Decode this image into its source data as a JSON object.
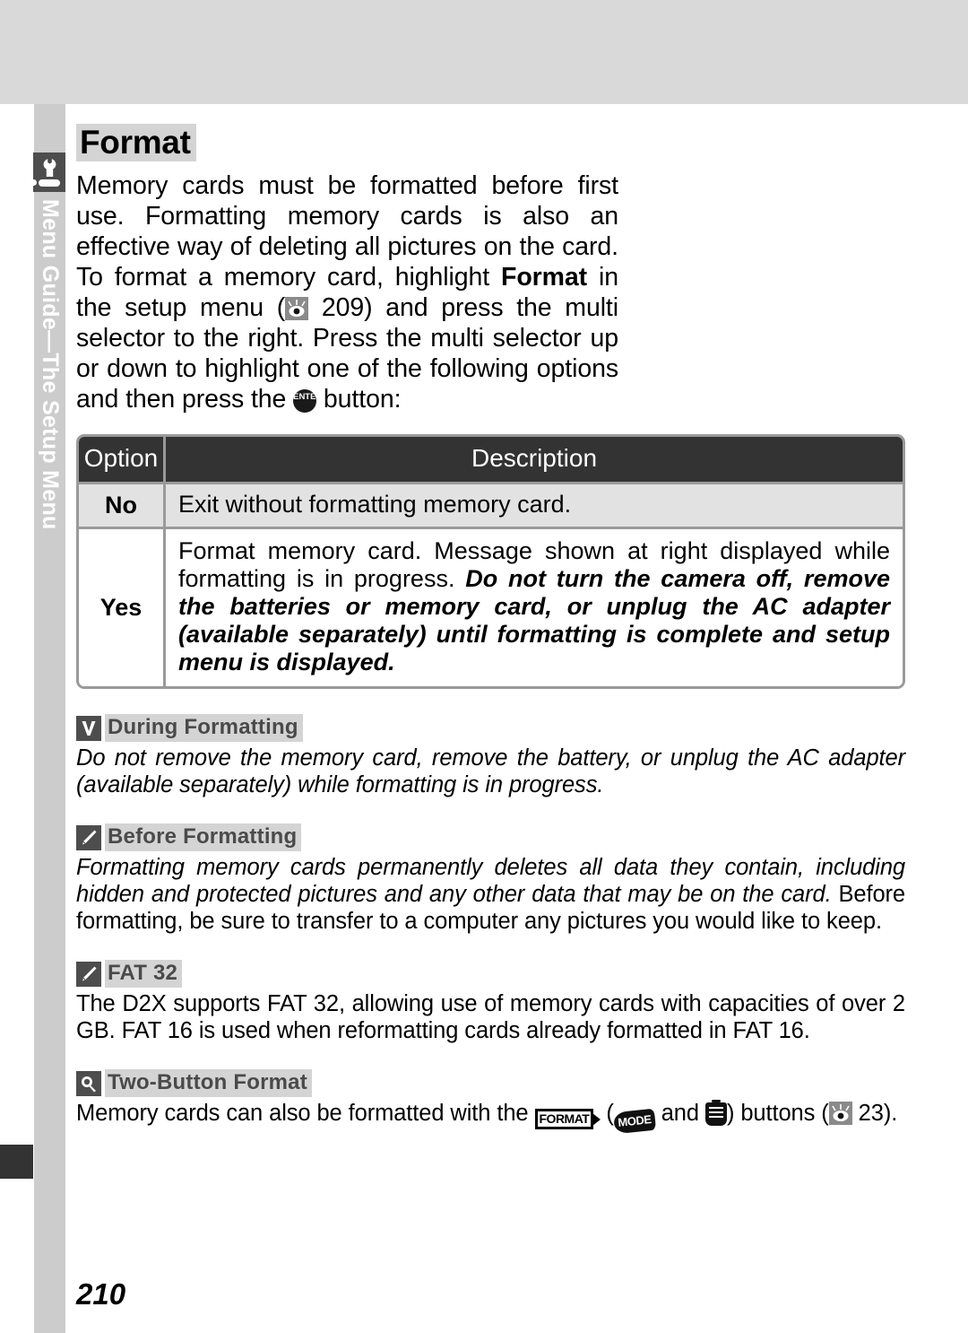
{
  "sidebar": {
    "tab_label": "Menu Guide—The Setup Menu",
    "icon": "wrench-setup-icon"
  },
  "page": {
    "title": "Format",
    "number": "210"
  },
  "intro": {
    "part1": "Memory cards must be formatted before first use. Formatting memory cards is also an effective way of deleting all pictures on the card.  To format a memory card, highlight ",
    "bold1": "Format",
    "part2": " in the setup menu (",
    "ref_icon": "eye-reference-icon",
    "ref_page": "209",
    "part3": ") and press the multi selector to the right.  Press the multi selector up or down to highlight one of the following options and then press the ",
    "enter_icon": "enter-button-icon",
    "enter_label": "ENTER",
    "part4": " button:"
  },
  "table": {
    "headers": [
      "Option",
      "Description"
    ],
    "rows": [
      {
        "option": "No",
        "description": "Exit without formatting memory card.",
        "description_italic": ""
      },
      {
        "option": "Yes",
        "description": "Format memory card.  Message shown at right displayed while formatting is in progress.  ",
        "description_italic": "Do not turn the camera off, remove the batteries or memory card, or unplug the AC adapter (available separately) until formatting is complete and setup menu is displayed."
      }
    ]
  },
  "notes": [
    {
      "icon": "caution-checkmark-icon",
      "title": "During Formatting",
      "body_italic": "Do not remove the memory card, remove the battery, or unplug the AC adapter (available separately) while formatting is in progress.",
      "body_plain": ""
    },
    {
      "icon": "pencil-icon",
      "title": "Before Formatting",
      "body_italic": "Formatting memory cards permanently deletes all data they contain, including hidden and protected pictures and any other data that may be on the card. ",
      "body_plain": "Before formatting, be sure to transfer to a computer any pictures you would like to keep."
    },
    {
      "icon": "pencil-icon",
      "title": "FAT 32",
      "body_italic": "",
      "body_plain": "The D2X supports FAT 32, allowing use of memory cards with capacities of over 2 GB. FAT 16 is used when reformatting cards already formatted in FAT 16."
    }
  ],
  "two_button": {
    "icon": "magnifier-icon",
    "title": "Two-Button Format",
    "text_before": "Memory cards can also be formatted with the ",
    "format_icon_label": "FORMAT",
    "text_mid1": " (",
    "mode_icon_label": "MODE",
    "text_mid2": " and ",
    "trash_icon": "trash-button-icon",
    "text_mid3": ") buttons (",
    "ref_icon": "eye-reference-icon",
    "ref_page": "23",
    "text_after": ")."
  },
  "colors": {
    "top_band": "#d9d9d9",
    "rail": "#cccccc",
    "tab_marker": "#333333",
    "icon_dark": "#4d4d4d",
    "heading_highlight": "#d4d4d4",
    "table_header": "#333333",
    "table_row_alt": "#e2e2e2",
    "table_border": "#9a9a9a"
  }
}
